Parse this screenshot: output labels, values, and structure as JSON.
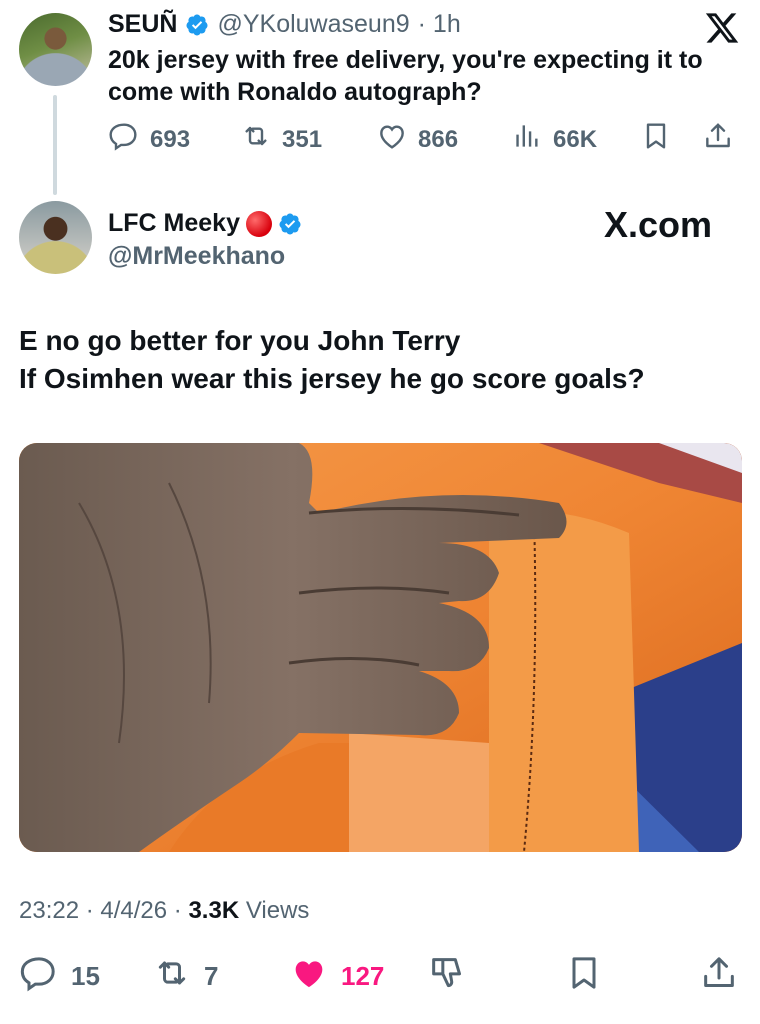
{
  "parent_tweet": {
    "author_name": "SEUÑ",
    "handle": "@YKoluwaseun9",
    "time": "· 1h",
    "text": "20k jersey with free delivery, you're expecting it to come with Ronaldo autograph?",
    "replies": "693",
    "reposts": "351",
    "likes": "866",
    "views": "66K",
    "icons": [
      "reply-icon",
      "repost-icon",
      "like-icon",
      "views-icon",
      "bookmark-icon",
      "share-icon"
    ]
  },
  "main_tweet": {
    "author_name": "LFC Meeky",
    "handle": "@MrMeekhano",
    "watermark": "X.com",
    "line1": "E no go better for you John Terry",
    "line2": "If Osimhen wear this jersey he go score goals?",
    "timestamp": "23:22 · 4/4/26 ·",
    "views_count": "3.3K",
    "views_label": "Views",
    "replies": "15",
    "reposts": "7",
    "likes": "127",
    "liked": true,
    "icons": [
      "reply-icon",
      "repost-icon",
      "like-icon",
      "dislike-icon",
      "bookmark-icon",
      "share-icon"
    ]
  },
  "colors": {
    "text": "#0f1419",
    "secondary": "#536471",
    "verified": "#1d9bf0",
    "like": "#f91880",
    "thread_line": "#cfd9de"
  }
}
